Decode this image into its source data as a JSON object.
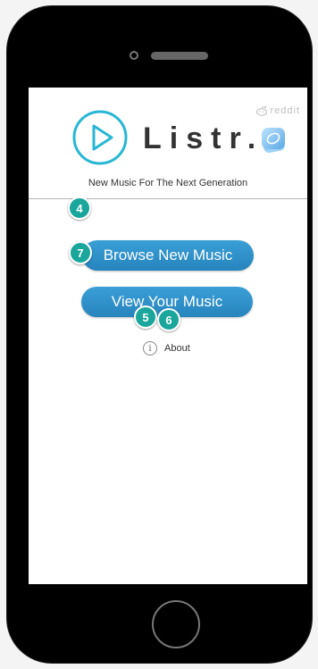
{
  "app": {
    "brand": "Listr.",
    "tagline": "New Music For The Next Generation",
    "reddit_label": "reddit"
  },
  "buttons": {
    "browse_label": "Browse New Music",
    "view_label": "View Your Music"
  },
  "about": {
    "label": "About",
    "icon_glyph": "i"
  },
  "markers": [
    "4",
    "7",
    "5",
    "6"
  ],
  "colors": {
    "accent": "#2a8ac6",
    "logo_teal": "#27b7d4",
    "marker": "#1aa69b"
  }
}
